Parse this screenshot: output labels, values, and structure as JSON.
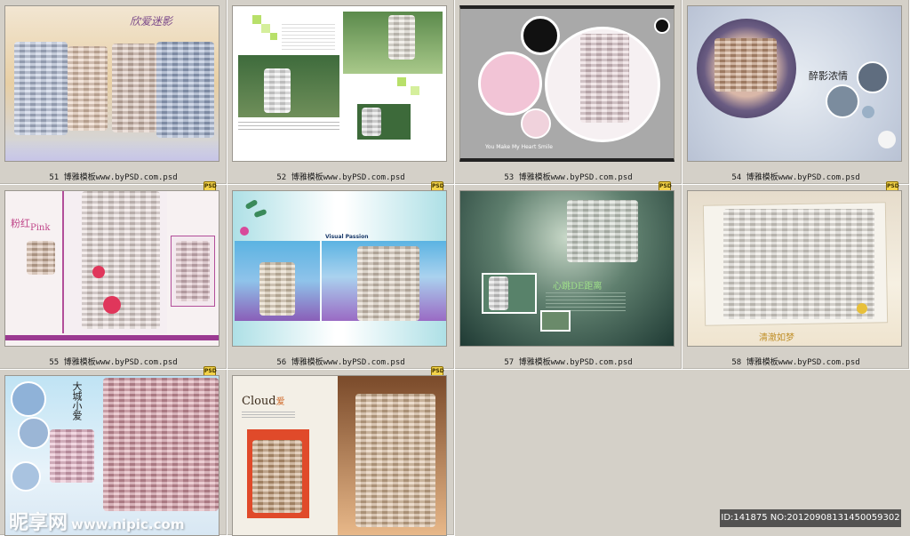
{
  "thumbnails": [
    {
      "caption": "51 博雅模板www.byPSD.com.psd",
      "title": "欣爱迷影"
    },
    {
      "caption": "52 博雅模板www.byPSD.com.psd"
    },
    {
      "caption": "53 博雅模板www.byPSD.com.psd",
      "tagline": "You Make My Heart Smile"
    },
    {
      "caption": "54 博雅模板www.byPSD.com.psd",
      "title": "醉影浓情"
    },
    {
      "caption": "55 博雅模板www.byPSD.com.psd",
      "title_cn": "粉红",
      "title_en": "Pink"
    },
    {
      "caption": "56 博雅模板www.byPSD.com.psd",
      "tagline": "Visual Passion"
    },
    {
      "caption": "57 博雅模板www.byPSD.com.psd",
      "title": "心跳DE距离"
    },
    {
      "caption": "58 博雅模板www.byPSD.com.psd",
      "title": "清澈如梦"
    },
    {
      "caption": "",
      "title": "大城小爱"
    },
    {
      "caption": "",
      "title": "Cloud",
      "title_suffix": "爱"
    }
  ],
  "badge_label": "PSD",
  "watermark": {
    "logo": "昵享网",
    "url": "www.nipic.com"
  },
  "id_bar": "ID:141875 NO:20120908131450059302",
  "colors": {
    "background": "#d4d0c8",
    "caption": "#1a1a1a"
  }
}
